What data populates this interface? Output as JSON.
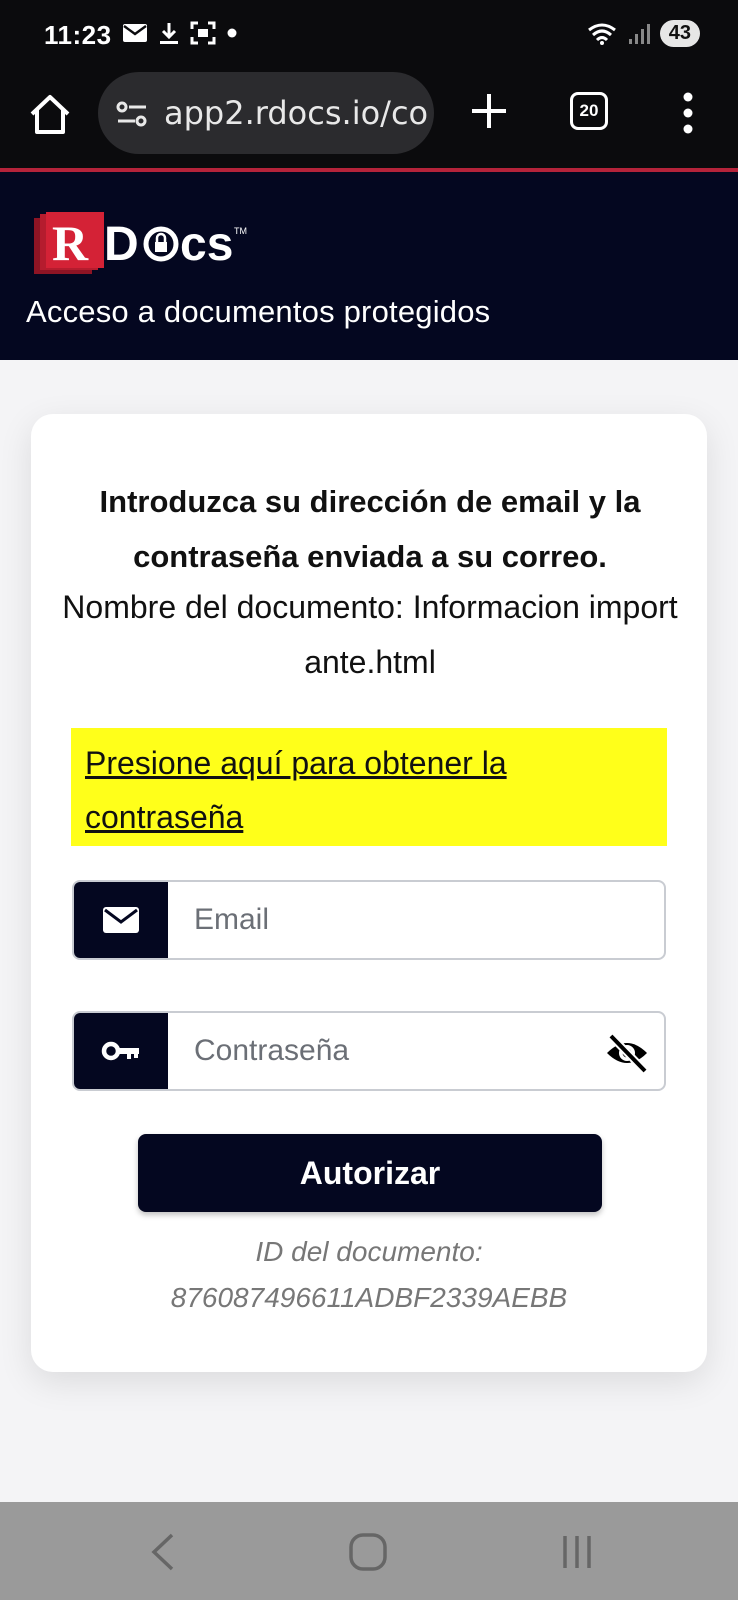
{
  "status_bar": {
    "time": "11:23",
    "battery": "43"
  },
  "browser": {
    "url": "app2.rdocs.io/co",
    "tab_count": "20"
  },
  "header": {
    "logo_text": "RDocs",
    "subtitle": "Acceso a documentos protegidos"
  },
  "card": {
    "heading": "Introduzca su dirección de email y la contraseña enviada a su correo.",
    "document_name": "Nombre del documento: Informacion importante.html",
    "password_link": "Presione aquí para obtener la contraseña",
    "email_placeholder": "Email",
    "password_placeholder": "Contraseña",
    "submit_label": "Autorizar",
    "doc_id_label": "ID del documento:",
    "doc_id_value": "876087496611ADBF2339AEBB"
  },
  "colors": {
    "header_bg": "#040720",
    "accent_red": "#b5233a",
    "highlight_yellow": "#ffff1a"
  }
}
